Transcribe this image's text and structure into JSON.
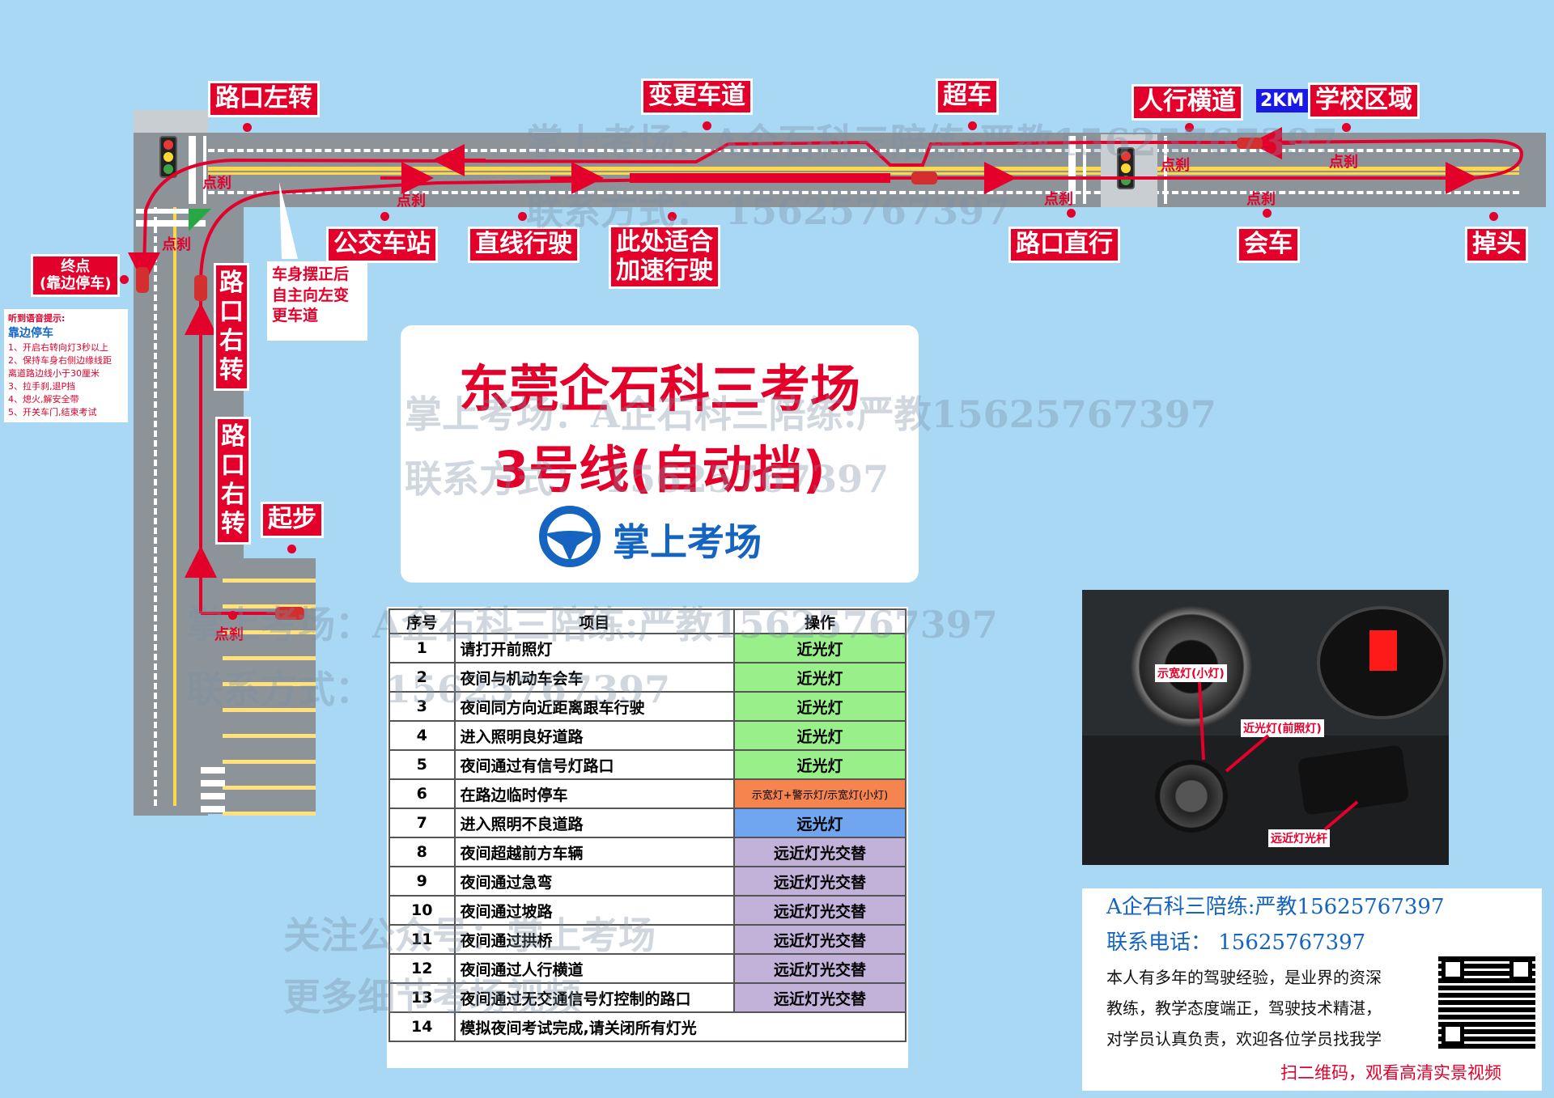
{
  "card": {
    "title": "东莞企石科三考场",
    "subtitle": "3号线(自动挡)",
    "brand": "掌上考场"
  },
  "labels": {
    "left_turn": "路口左转",
    "lane_change": "变更车道",
    "overtake": "超车",
    "crosswalk": "人行横道",
    "distance": "2KM",
    "school_zone": "学校区域",
    "bus_stop": "公交车站",
    "straight_drive": "直线行驶",
    "accelerate_line1": "此处适合",
    "accelerate_line2": "加速行驶",
    "intersection_straight": "路口直行",
    "meeting": "会车",
    "u_turn": "掉头",
    "right_turn_1": "路口右转",
    "right_turn_2": "路口右转",
    "start": "起步",
    "end_line1": "终点",
    "end_line2": "(靠边停车)",
    "left_change_note_1": "车身摆正后",
    "left_change_note_2": "自主向左变",
    "left_change_note_3": "更车道",
    "brake": "点刹"
  },
  "voice_tip": {
    "heading": "听到语音提示:",
    "title": "靠边停车",
    "steps": [
      "1、开启右转向灯3秒以上",
      "2、保持车身右侧边缘线距",
      "离道路边线小于30厘米",
      "3、拉手刹,退P挡",
      "4、熄火,解安全带",
      "5、开关车门,结束考试"
    ]
  },
  "watermarks": {
    "line1": "掌上考场：A企石科三陪练:严教15625767397",
    "line2": "联系方式：  15625767397",
    "line3": "关注公众号：掌上考场",
    "line4": "更多细节考场视频"
  },
  "table": {
    "headers": [
      "序号",
      "项目",
      "操作"
    ],
    "rows": [
      {
        "n": "1",
        "item": "请打开前照灯",
        "op": "近光灯",
        "color": "#99f08a"
      },
      {
        "n": "2",
        "item": "夜间与机动车会车",
        "op": "近光灯",
        "color": "#99f08a"
      },
      {
        "n": "3",
        "item": "夜间同方向近距离跟车行驶",
        "op": "近光灯",
        "color": "#99f08a"
      },
      {
        "n": "4",
        "item": "进入照明良好道路",
        "op": "近光灯",
        "color": "#99f08a"
      },
      {
        "n": "5",
        "item": "夜间通过有信号灯路口",
        "op": "近光灯",
        "color": "#99f08a"
      },
      {
        "n": "6",
        "item": "在路边临时停车",
        "op": "示宽灯+警示灯/示宽灯(小灯)",
        "color": "#f5844f"
      },
      {
        "n": "7",
        "item": "进入照明不良道路",
        "op": "远光灯",
        "color": "#6fa6ef"
      },
      {
        "n": "8",
        "item": "夜间超越前方车辆",
        "op": "远近灯光交替",
        "color": "#c2b1d9"
      },
      {
        "n": "9",
        "item": "夜间通过急弯",
        "op": "远近灯光交替",
        "color": "#c2b1d9"
      },
      {
        "n": "10",
        "item": "夜间通过坡路",
        "op": "远近灯光交替",
        "color": "#c2b1d9"
      },
      {
        "n": "11",
        "item": "夜间通过拱桥",
        "op": "远近灯光交替",
        "color": "#c2b1d9"
      },
      {
        "n": "12",
        "item": "夜间通过人行横道",
        "op": "远近灯光交替",
        "color": "#c2b1d9"
      },
      {
        "n": "13",
        "item": "夜间通过无交通信号灯控制的路口",
        "op": "远近灯光交替",
        "color": "#c2b1d9"
      },
      {
        "n": "14",
        "item": "模拟夜间考试完成,请关闭所有灯光",
        "op": "",
        "color": "#ffffff"
      }
    ]
  },
  "photo_labels": {
    "side_light": "示宽灯(小灯)",
    "low_beam": "近光灯(前照灯)",
    "high_beam_stalk": "远近灯光杆"
  },
  "contact": {
    "line1": "A企石科三陪练:严教15625767397",
    "line2": "联系电话：  15625767397",
    "desc1": "本人有多年的驾驶经验，是业界的资深",
    "desc2": "教练，教学态度端正，驾驶技术精湛，",
    "desc3": "对学员认真负责，欢迎各位学员找我学",
    "qr_caption": "扫二维码，观看高清实景视频"
  },
  "colors": {
    "accent_red": "#e3002a",
    "brand_blue": "#1565c0",
    "background": "#a9d8f5"
  }
}
